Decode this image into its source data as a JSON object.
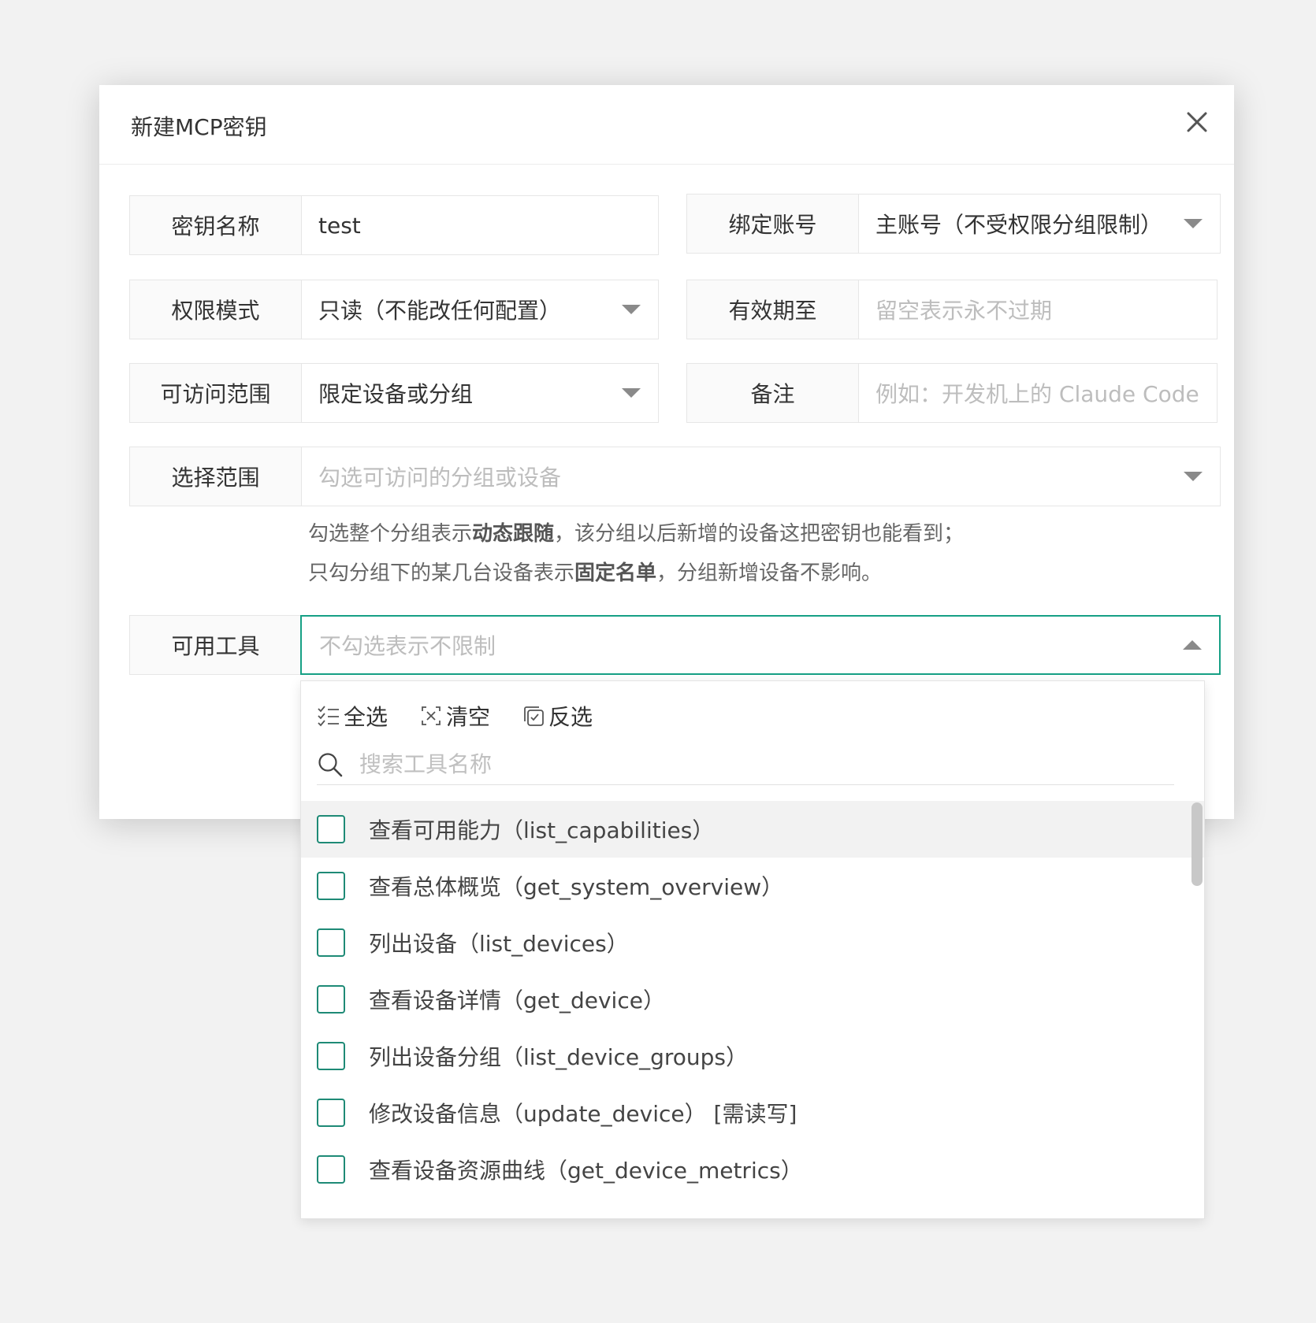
{
  "dialog": {
    "title": "新建MCP密钥"
  },
  "fields": {
    "key_name": {
      "label": "密钥名称",
      "value": "test"
    },
    "bind_account": {
      "label": "绑定账号",
      "value": "主账号（不受权限分组限制）"
    },
    "permission_mode": {
      "label": "权限模式",
      "value": "只读（不能改任何配置）"
    },
    "valid_until": {
      "label": "有效期至",
      "placeholder": "留空表示永不过期"
    },
    "access_scope": {
      "label": "可访问范围",
      "value": "限定设备或分组"
    },
    "remark": {
      "label": "备注",
      "placeholder": "例如：开发机上的 Claude Code"
    },
    "select_scope": {
      "label": "选择范围",
      "placeholder": "勾选可访问的分组或设备"
    },
    "tools": {
      "label": "可用工具",
      "placeholder": "不勾选表示不限制"
    }
  },
  "hint": {
    "line1_prefix": "勾选整个分组表示",
    "line1_bold": "动态跟随",
    "line1_suffix": "，该分组以后新增的设备这把密钥也能看到；",
    "line2_prefix": "只勾分组下的某几台设备表示",
    "line2_bold": "固定名单",
    "line2_suffix": "，分组新增设备不影响。"
  },
  "dropdown": {
    "select_all": "全选",
    "clear": "清空",
    "invert": "反选",
    "search_placeholder": "搜索工具名称",
    "items": [
      {
        "label": "查看可用能力（list_capabilities）",
        "checked": false
      },
      {
        "label": "查看总体概览（get_system_overview）",
        "checked": false
      },
      {
        "label": "列出设备（list_devices）",
        "checked": false
      },
      {
        "label": "查看设备详情（get_device）",
        "checked": false
      },
      {
        "label": "列出设备分组（list_device_groups）",
        "checked": false
      },
      {
        "label": "修改设备信息（update_device） [需读写]",
        "checked": false
      },
      {
        "label": "查看设备资源曲线（get_device_metrics）",
        "checked": false
      }
    ]
  },
  "colors": {
    "accent": "#16a085",
    "checkbox_border": "#1e8a76"
  }
}
